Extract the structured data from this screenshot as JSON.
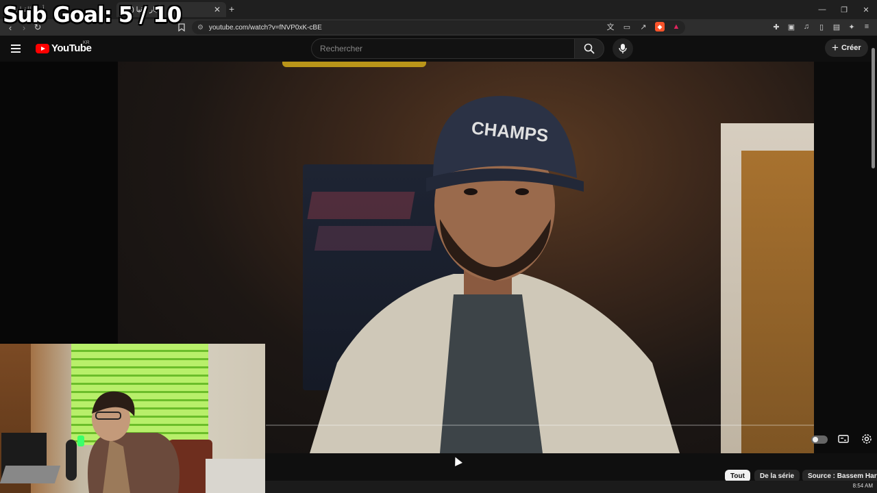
{
  "browser": {
    "tabs": [
      {
        "title": "(49) أبيار القيا"
      },
      {
        "title": "(49) أبيار القيا"
      }
    ],
    "new_tab_label": "+",
    "url": "youtube.com/watch?v=fNVP0xK-cBE"
  },
  "youtube": {
    "logo_text": "YouTube",
    "region_code": "KR",
    "search_placeholder": "Rechercher",
    "create_label": "Créer",
    "chips": [
      "Tout",
      "De la série",
      "Source : Bassem Harfin"
    ]
  },
  "overlay": {
    "sub_goal_text": "Sub Goal:  5 / 10"
  },
  "taskbar": {
    "time": "8:54 AM"
  }
}
